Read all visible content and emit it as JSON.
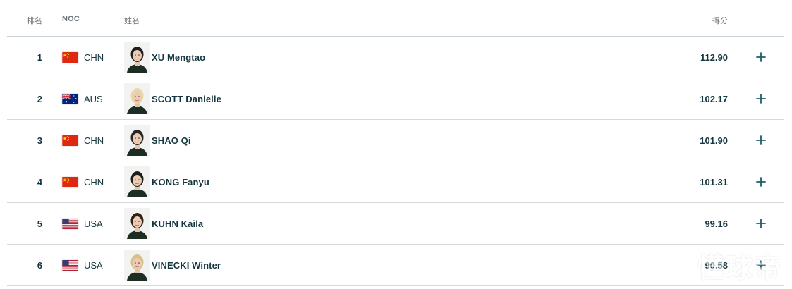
{
  "table": {
    "headers": {
      "rank": "排名",
      "noc": "NOC",
      "name": "姓名",
      "score": "得分"
    },
    "rows": [
      {
        "rank": "1",
        "noc": "CHN",
        "flag": "china-flag",
        "name": "XU Mengtao",
        "score": "112.90",
        "avatar_hair": "#1f1f1f"
      },
      {
        "rank": "2",
        "noc": "AUS",
        "flag": "australia-flag",
        "name": "SCOTT Danielle",
        "score": "102.17",
        "avatar_hair": "#e9d7a8"
      },
      {
        "rank": "3",
        "noc": "CHN",
        "flag": "china-flag",
        "name": "SHAO Qi",
        "score": "101.90",
        "avatar_hair": "#262626"
      },
      {
        "rank": "4",
        "noc": "CHN",
        "flag": "china-flag",
        "name": "KONG Fanyu",
        "score": "101.31",
        "avatar_hair": "#1d1d1d"
      },
      {
        "rank": "5",
        "noc": "USA",
        "flag": "usa-flag",
        "name": "KUHN Kaila",
        "score": "99.16",
        "avatar_hair": "#2e1f18"
      },
      {
        "rank": "6",
        "noc": "USA",
        "flag": "usa-flag",
        "name": "VINECKI Winter",
        "score": "90.58",
        "avatar_hair": "#d9c08a"
      }
    ]
  },
  "watermark": {
    "text": "懂球帝"
  },
  "colors": {
    "text_primary": "#13363f",
    "header_text": "#6b7378",
    "expand_icon": "#1b5e6b",
    "divider": "#d3d9dd"
  }
}
